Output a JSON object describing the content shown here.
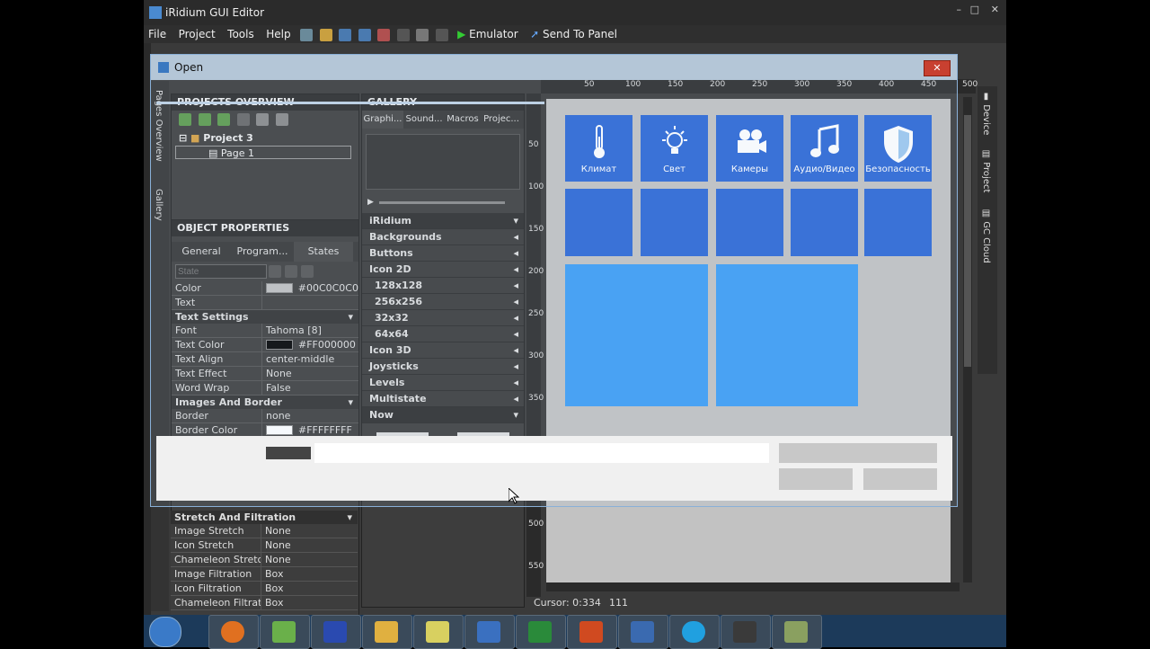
{
  "app": {
    "title": "iRidium GUI Editor"
  },
  "menu": {
    "items": [
      "File",
      "Project",
      "Tools",
      "Help"
    ],
    "emulator": "Emulator",
    "send": "Send To Panel"
  },
  "dialog": {
    "title": "Open"
  },
  "projects": {
    "header": "PROJECTS OVERVIEW",
    "project": "Project 3",
    "page": "Page 1"
  },
  "gallery": {
    "header": "GALLERY",
    "tabs": [
      "Graphi...",
      "Sound...",
      "Macros",
      "Projec..."
    ],
    "items": [
      {
        "label": "iRidium",
        "style": "hdr"
      },
      {
        "label": "Backgrounds",
        "style": ""
      },
      {
        "label": "Buttons",
        "style": ""
      },
      {
        "label": "Icon 2D",
        "style": ""
      },
      {
        "label": "128x128",
        "style": "sub"
      },
      {
        "label": "256x256",
        "style": "sub"
      },
      {
        "label": "32x32",
        "style": "sub"
      },
      {
        "label": "64x64",
        "style": "sub"
      },
      {
        "label": "Icon 3D",
        "style": ""
      },
      {
        "label": "Joysticks",
        "style": ""
      },
      {
        "label": "Levels",
        "style": ""
      },
      {
        "label": "Multistate",
        "style": ""
      },
      {
        "label": "Now",
        "style": "hdr"
      }
    ]
  },
  "props": {
    "header": "OBJECT PROPERTIES",
    "tabs": [
      "General",
      "Program...",
      "States"
    ],
    "state_placeholder": "State",
    "rows1": [
      {
        "k": "Color",
        "v": "#00C0C0C0",
        "swatch": "#c0c0c0"
      },
      {
        "k": "Text",
        "v": "",
        "swatch": ""
      }
    ],
    "sect_text": "Text Settings",
    "rows2": [
      {
        "k": "Font",
        "v": "Tahoma [8]",
        "swatch": ""
      },
      {
        "k": "Text Color",
        "v": "#FF000000",
        "swatch": "#000000"
      },
      {
        "k": "Text Align",
        "v": "center-middle",
        "swatch": ""
      },
      {
        "k": "Text Effect",
        "v": "None",
        "swatch": ""
      },
      {
        "k": "Word Wrap",
        "v": "False",
        "swatch": ""
      }
    ],
    "sect_images": "Images And Border",
    "rows3": [
      {
        "k": "Border",
        "v": "none",
        "swatch": ""
      },
      {
        "k": "Border Color",
        "v": "#FFFFFFFF",
        "swatch": "#ffffff"
      }
    ],
    "sect_stretch": "Stretch And Filtration",
    "rows4": [
      {
        "k": "Image Stretch",
        "v": "None",
        "swatch": ""
      },
      {
        "k": "Icon Stretch",
        "v": "None",
        "swatch": ""
      },
      {
        "k": "Chameleon Stretch",
        "v": "None",
        "swatch": ""
      },
      {
        "k": "Image Filtration",
        "v": "Box",
        "swatch": ""
      },
      {
        "k": "Icon Filtration",
        "v": "Box",
        "swatch": ""
      },
      {
        "k": "Chameleon Filtration",
        "v": "Box",
        "swatch": ""
      }
    ]
  },
  "canvas": {
    "ruler_x": [
      "50",
      "100",
      "150",
      "200",
      "250",
      "300",
      "350",
      "400",
      "450",
      "500"
    ],
    "ruler_y": [
      "50",
      "100",
      "150",
      "200",
      "250",
      "300",
      "350",
      "500",
      "550"
    ],
    "tiles": [
      {
        "label": "Климат",
        "icon": "thermometer"
      },
      {
        "label": "Свет",
        "icon": "lightbulb"
      },
      {
        "label": "Камеры",
        "icon": "camera"
      },
      {
        "label": "Аудио/Видео",
        "icon": "music"
      },
      {
        "label": "Безопасность",
        "icon": "shield"
      }
    ],
    "cursor": "Cursor: 0:334",
    "cursor_extra": "111"
  },
  "side_tabs": [
    "Device",
    "Project",
    "GC Cloud"
  ],
  "left_vtabs": [
    "Pages Overview",
    "Gallery"
  ],
  "taskbar": {
    "items": [
      "firefox",
      "iridium-tool",
      "save",
      "folder",
      "notes",
      "iridium",
      "excel",
      "powerpoint",
      "tools",
      "skype",
      "media",
      "app"
    ]
  }
}
